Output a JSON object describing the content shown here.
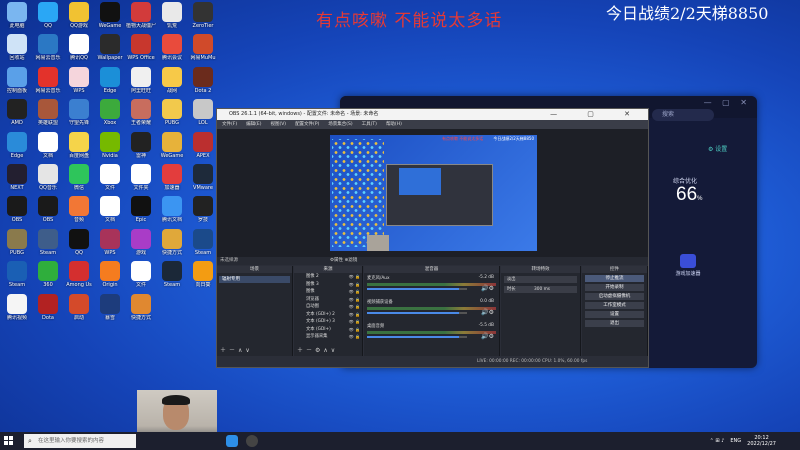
{
  "overlay": {
    "caption": "有点咳嗽 不能说太多话",
    "stats": "今日战绩2/2天梯8850"
  },
  "desktop": {
    "icons": [
      {
        "label": "此电脑",
        "color": "#7ab6f0"
      },
      {
        "label": "QQ",
        "color": "#2aa7f5"
      },
      {
        "label": "QQ游戏",
        "color": "#f1c232"
      },
      {
        "label": "WeGame",
        "color": "#111111"
      },
      {
        "label": "植物大战僵尸",
        "color": "#d23b3b"
      },
      {
        "label": "饥荒",
        "color": "#e9e9e9"
      },
      {
        "label": "ZeroTier",
        "color": "#333333"
      },
      {
        "label": "回收站",
        "color": "#cfe3f7"
      },
      {
        "label": "网易云音乐",
        "color": "#2b78c4"
      },
      {
        "label": "腾讯QQ",
        "color": "#ffffff"
      },
      {
        "label": "Wallpaper",
        "color": "#2b2b2b"
      },
      {
        "label": "WPS Office",
        "color": "#c8372d"
      },
      {
        "label": "腾讯会议",
        "color": "#e94b3c"
      },
      {
        "label": "网易MuMu",
        "color": "#d04a2a"
      },
      {
        "label": "控制面板",
        "color": "#5aa0e8"
      },
      {
        "label": "网易云音乐",
        "color": "#e3322b"
      },
      {
        "label": "WPS",
        "color": "#f5d5dc"
      },
      {
        "label": "Edge",
        "color": "#1b8fd8"
      },
      {
        "label": "阿里旺旺",
        "color": "#f0f0f0"
      },
      {
        "label": "战网",
        "color": "#f7c948"
      },
      {
        "label": "Dota 2",
        "color": "#6b2b1c"
      },
      {
        "label": "AMD",
        "color": "#222222"
      },
      {
        "label": "英雄联盟",
        "color": "#a8573a"
      },
      {
        "label": "守望先锋",
        "color": "#3b7fd0"
      },
      {
        "label": "Xbox",
        "color": "#3caa3c"
      },
      {
        "label": "王者荣耀",
        "color": "#c86d5e"
      },
      {
        "label": "PUBG",
        "color": "#f2c94c"
      },
      {
        "label": "LOL",
        "color": "#c8c8c8"
      },
      {
        "label": "Edge",
        "color": "#2a8bd9"
      },
      {
        "label": "文档",
        "color": "#ffffff"
      },
      {
        "label": "百度网盘",
        "color": "#f5d44a"
      },
      {
        "label": "Nvidia",
        "color": "#76b900"
      },
      {
        "label": "雷神",
        "color": "#222222"
      },
      {
        "label": "WeGame",
        "color": "#e7b23a"
      },
      {
        "label": "APEX",
        "color": "#bb2f2f"
      },
      {
        "label": "NEXT",
        "color": "#231f30"
      },
      {
        "label": "QQ音乐",
        "color": "#e5e5e5"
      },
      {
        "label": "微信",
        "color": "#2ec55b"
      },
      {
        "label": "文件",
        "color": "#ffffff"
      },
      {
        "label": "文件夹",
        "color": "#ffffff"
      },
      {
        "label": "加速器",
        "color": "#e33d3d"
      },
      {
        "label": "VMware",
        "color": "#1e2a3a"
      },
      {
        "label": "OBS",
        "color": "#1a1a1a"
      },
      {
        "label": "OBS",
        "color": "#1a1a1a"
      },
      {
        "label": "音频",
        "color": "#f27735"
      },
      {
        "label": "文档",
        "color": "#ffffff"
      },
      {
        "label": "Epic",
        "color": "#111111"
      },
      {
        "label": "腾讯文档",
        "color": "#3b95f2"
      },
      {
        "label": "罗技",
        "color": "#222222"
      },
      {
        "label": "PUBG",
        "color": "#8a7a4c"
      },
      {
        "label": "Steam",
        "color": "#3e5d8a"
      },
      {
        "label": "QQ",
        "color": "#111111"
      },
      {
        "label": "WPS",
        "color": "#a8335a"
      },
      {
        "label": "游戏",
        "color": "#a93cc7"
      },
      {
        "label": "快捷方式",
        "color": "#e0a83a"
      },
      {
        "label": "Steam",
        "color": "#1b4a8a"
      },
      {
        "label": "Steam",
        "color": "#1a5fb4"
      },
      {
        "label": "360",
        "color": "#2fae3c"
      },
      {
        "label": "Among Us",
        "color": "#d42f2f"
      },
      {
        "label": "Origin",
        "color": "#f57c1f"
      },
      {
        "label": "文件",
        "color": "#ffffff"
      },
      {
        "label": "Steam",
        "color": "#1b2838"
      },
      {
        "label": "向日葵",
        "color": "#f39c12"
      },
      {
        "label": "腾讯视频",
        "color": "#f5f5f5"
      },
      {
        "label": "Dota",
        "color": "#b22222"
      },
      {
        "label": "启动",
        "color": "#d44a2a"
      },
      {
        "label": "暴雪",
        "color": "#1d3c7c"
      },
      {
        "label": "快捷方式",
        "color": "#e08830"
      }
    ]
  },
  "game_client": {
    "search_placeholder": "搜索",
    "settings_label": "设置",
    "optimize_title": "综合优化",
    "optimize_value": "66",
    "optimize_unit": "%",
    "game_center_label": "游戏加速器"
  },
  "obs": {
    "title": "OBS 26.1.1 (64-bit, windows) - 配置文件: 未命名 - 场景: 未命名",
    "menu": [
      "文件(F)",
      "编辑(E)",
      "视图(V)",
      "配置文件(P)",
      "场景集合(S)",
      "工具(T)",
      "帮助(H)"
    ],
    "preview_caption": "今日战绩2/2天梯8850",
    "preview_red": "有点咳嗽 不能说太多话",
    "scene_bar": "未选择源",
    "scene_bar_btns": "⚙属性  ⊕滤镜",
    "docks": {
      "scenes": "场景",
      "sources": "来源",
      "mixer": "混音器",
      "transitions": "转场特效",
      "controls": "控件"
    },
    "scenes": [
      "辐射专用"
    ],
    "sources": [
      "图像 2",
      "图像 3",
      "图像",
      "浏览器",
      "自动图",
      "文本 (GDI+) 2",
      "文本 (GDI+) 3",
      "文本 (GDI+)",
      "显示器采集"
    ],
    "mixer_channels": [
      {
        "name": "麦克风/Aux",
        "db": "-5.2 dB"
      },
      {
        "name": "视频捕获设备",
        "db": "0.0 dB"
      },
      {
        "name": "桌面音频",
        "db": "-5.5 dB"
      }
    ],
    "transition": {
      "type": "淡出",
      "duration_label": "时长",
      "duration_value": "300 ms"
    },
    "controls": [
      "停止推流",
      "开始录制",
      "启动虚拟摄像机",
      "工作室模式",
      "设置",
      "退出"
    ],
    "status": "LIVE: 00:00:00   REC: 00:00:00   CPU: 1.0%, 60.00 fps"
  },
  "taskbar": {
    "search_placeholder": "在这里输入你要搜索的内容",
    "lang": "ENG",
    "time": "20:12",
    "date": "2022/12/27"
  }
}
